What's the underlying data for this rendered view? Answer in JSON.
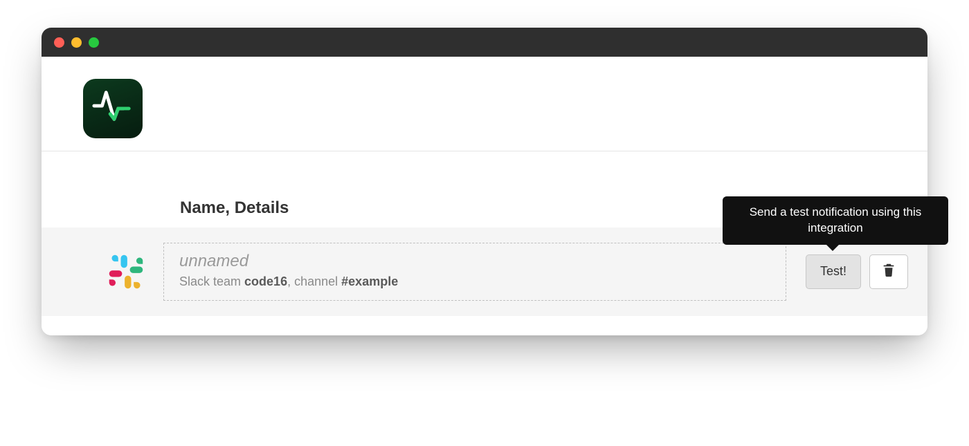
{
  "header": {
    "logo_icon": "pulse-icon"
  },
  "table": {
    "column_header": "Name, Details",
    "row": {
      "integration_icon": "slack-icon",
      "name": "unnamed",
      "details_prefix": "Slack team ",
      "details_team": "code16",
      "details_mid": ", channel ",
      "details_channel": "#example"
    }
  },
  "actions": {
    "test_label": "Test!",
    "delete_icon": "trash-icon",
    "tooltip_text": "Send a test notification using this integration"
  }
}
